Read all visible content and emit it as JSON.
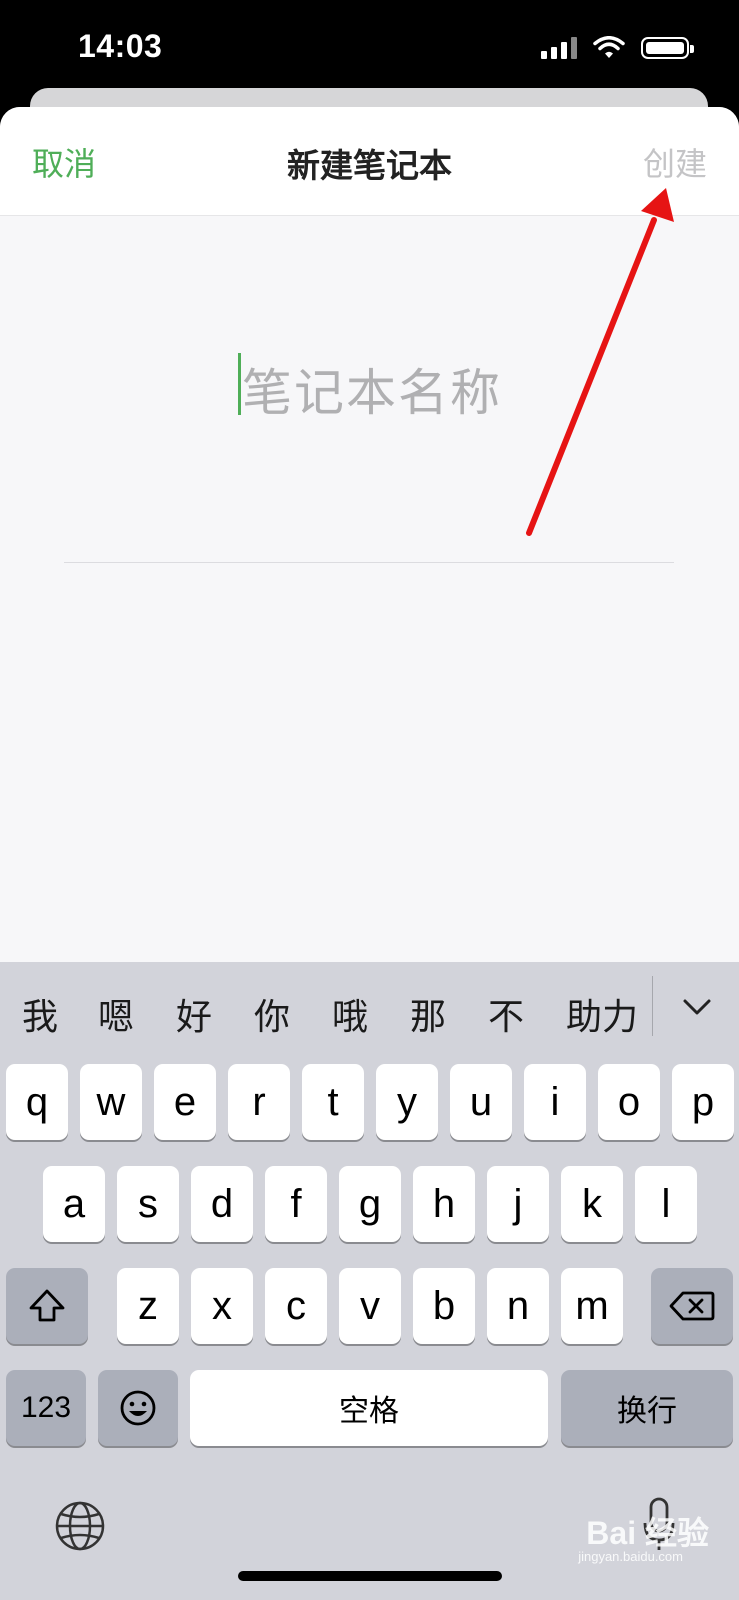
{
  "status_bar": {
    "time": "14:03",
    "icons": [
      "signal-icon",
      "wifi-icon",
      "battery-icon"
    ]
  },
  "nav": {
    "cancel_label": "取消",
    "title": "新建笔记本",
    "create_label": "创建"
  },
  "form": {
    "name_placeholder": "笔记本名称",
    "name_value": ""
  },
  "keyboard": {
    "candidates": [
      "我",
      "嗯",
      "好",
      "你",
      "哦",
      "那",
      "不",
      "助力"
    ],
    "rows": [
      [
        "q",
        "w",
        "e",
        "r",
        "t",
        "y",
        "u",
        "i",
        "o",
        "p"
      ],
      [
        "a",
        "s",
        "d",
        "f",
        "g",
        "h",
        "j",
        "k",
        "l"
      ],
      [
        "z",
        "x",
        "c",
        "v",
        "b",
        "n",
        "m"
      ]
    ],
    "numbers_label": "123",
    "space_label": "空格",
    "return_label": "换行"
  },
  "watermark": {
    "text": "Bai 经验",
    "url": "jingyan.baidu.com"
  },
  "colors": {
    "accent": "#4fae58",
    "disabled": "#c4c4c6",
    "annotation_arrow": "#e61414"
  }
}
